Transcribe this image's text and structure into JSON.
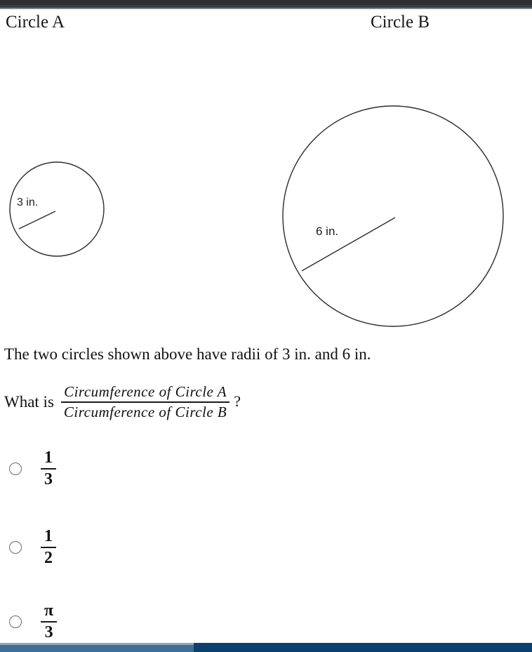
{
  "headings": {
    "circle_a": "Circle A",
    "circle_b": "Circle B"
  },
  "diagrams": [
    {
      "name": "circle-a",
      "label": "3 in.",
      "radius_value": 3,
      "radius_unit": "in."
    },
    {
      "name": "circle-b",
      "label": "6 in.",
      "radius_value": 6,
      "radius_unit": "in."
    }
  ],
  "statement": "The two circles shown above have radii of 3 in. and 6 in.",
  "question": {
    "lead": "What is",
    "numerator": "Circumference  of  Circle  A",
    "denominator": "Circumference  of  Circle  B",
    "trailing": "?"
  },
  "choices": [
    {
      "numerator": "1",
      "denominator": "3",
      "selected": false
    },
    {
      "numerator": "1",
      "denominator": "2",
      "selected": false
    },
    {
      "numerator": "π",
      "denominator": "3",
      "selected": false
    }
  ],
  "colors": {
    "page_background": "#ffffff",
    "text": "#111114",
    "top_bar": "#2d2f33",
    "scrollbar_track": "#0d3f6e",
    "scrollbar_thumb": "#3e6f96",
    "stroke": "#2b2b2b"
  },
  "scrollbar": {
    "orientation": "horizontal",
    "thumb_fraction": 0.364
  }
}
